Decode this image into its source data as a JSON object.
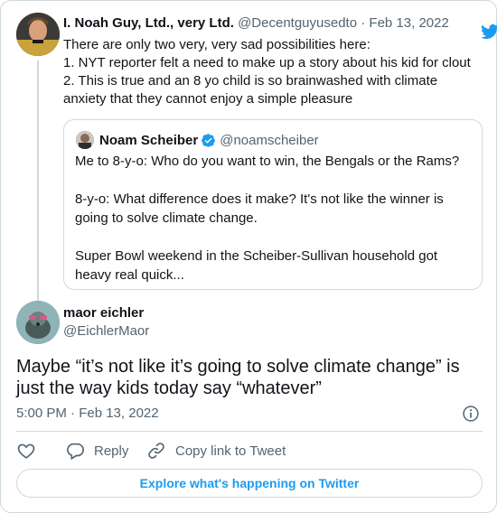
{
  "parent_tweet": {
    "name": "I. Noah Guy, Ltd., very Ltd.",
    "handle": "@Decentguyusedto",
    "separator": " · ",
    "date": "Feb 13, 2022",
    "lines": [
      "There are only two very, very sad possibilities here:",
      "1. NYT reporter felt a need to make up a story about his kid for clout",
      "2. This is true and an 8 yo child is so brainwashed with climate",
      "anxiety that they cannot enjoy a simple pleasure"
    ]
  },
  "quoted_tweet": {
    "name": "Noam Scheiber",
    "handle": "@noamscheiber",
    "lines": [
      "Me to 8-y-o: Who do you want to win, the Bengals or the Rams?",
      "",
      "8-y-o: What difference does it make? It's not like the winner is",
      "going to solve climate change.",
      "",
      "Super Bowl weekend in the Scheiber-Sullivan household got",
      "heavy real quick..."
    ]
  },
  "main_tweet": {
    "name": "maor eichler",
    "handle": "@EichlerMaor",
    "lines": [
      "Maybe “it’s not like it’s going to solve climate change” is",
      "just the way kids today say “whatever”"
    ],
    "timestamp": "5:00 PM · Feb 13, 2022"
  },
  "actions": {
    "reply_label": "Reply",
    "copy_link_label": "Copy link to Tweet"
  },
  "explore_label": "Explore what's happening on Twitter",
  "icons": {
    "logo": "twitter-bird-icon",
    "verified": "verified-badge-icon",
    "info": "info-icon",
    "like": "heart-icon",
    "reply": "reply-bubble-icon",
    "copy_link": "link-icon"
  },
  "colors": {
    "accent": "#1d9bf0",
    "text": "#0f1419",
    "muted": "#536471",
    "border": "#cfd9de"
  }
}
